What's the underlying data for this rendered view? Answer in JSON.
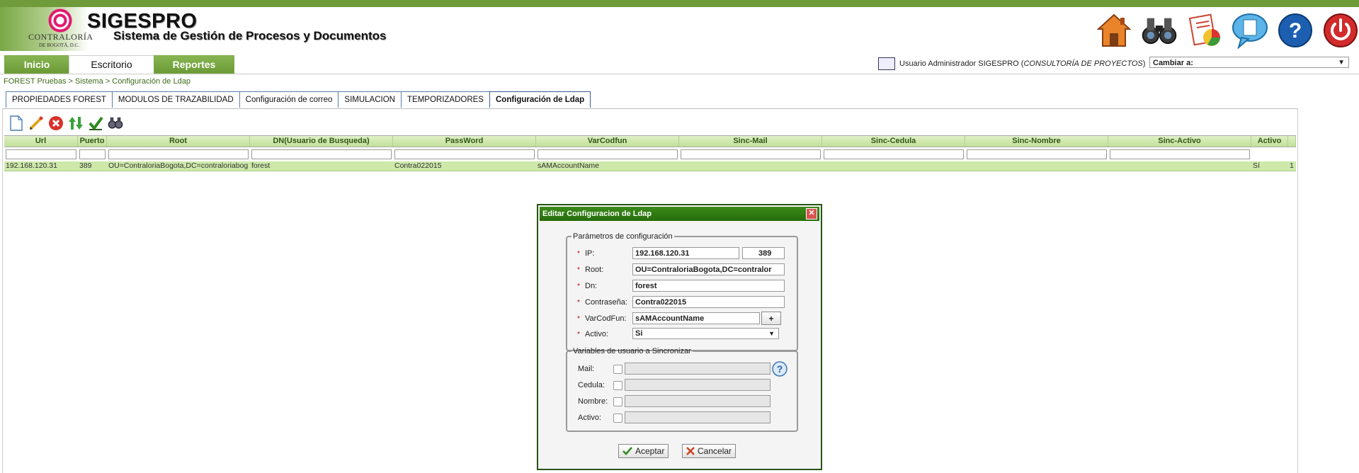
{
  "app": {
    "title": "SIGESPRO",
    "subtitle": "Sistema de Gestión de Procesos y Documentos",
    "logo_name": "CONTRALORÍA",
    "logo_sub": "DE BOGOTÁ, D.C."
  },
  "top_icons": [
    "home-icon",
    "binoculars-icon",
    "reports-icon",
    "chat-icon",
    "help-icon",
    "power-icon"
  ],
  "main_tabs": [
    {
      "label": "Inicio"
    },
    {
      "label": "Escritorio"
    },
    {
      "label": "Reportes"
    }
  ],
  "user": {
    "prefix": "Usuario Administrador SIGESPRO (",
    "role": "CONSULTORÍA DE PROYECTOS",
    "suffix": ")"
  },
  "switch": {
    "label": "Cambiar a:"
  },
  "breadcrumb": "FOREST Pruebas > Sistema > Configuración de Ldap",
  "sub_tabs": [
    {
      "label": "PROPIEDADES FOREST"
    },
    {
      "label": "MODULOS DE TRAZABILIDAD"
    },
    {
      "label": "Configuración de correo"
    },
    {
      "label": "SIMULACION"
    },
    {
      "label": "TEMPORIZADORES"
    },
    {
      "label": "Configuración de Ldap"
    }
  ],
  "toolbar_icons": [
    "new-icon",
    "edit-icon",
    "delete-icon",
    "sync-icon",
    "check-icon",
    "search-icon"
  ],
  "grid": {
    "columns": [
      "Url",
      "Puerto",
      "Root",
      "DN(Usuario de Busqueda)",
      "PassWord",
      "VarCodfun",
      "Sinc-Mail",
      "Sinc-Cedula",
      "Sinc-Nombre",
      "Sinc-Activo",
      "Activo"
    ],
    "rows": [
      [
        "192.168.120.31",
        "389",
        "OU=ContraloriaBogota,DC=contraloriabog",
        "forest",
        "Contra022015",
        "sAMAccountName",
        "",
        "",
        "",
        "",
        "Sí",
        "1"
      ]
    ]
  },
  "dialog": {
    "title": "Editar Configuracion de Ldap",
    "params_legend": "Parámetros de configuración",
    "fields": {
      "ip_label": "IP:",
      "ip_value": "192.168.120.31",
      "port_value": "389",
      "root_label": "Root:",
      "root_value": "OU=ContraloriaBogota,DC=contralor",
      "dn_label": "Dn:",
      "dn_value": "forest",
      "pass_label": "Contraseña:",
      "pass_value": "Contra022015",
      "varcod_label": "VarCodFun:",
      "varcod_value": "sAMAccountName",
      "plus": "+",
      "activo_label": "Activo:",
      "activo_value": "Si"
    },
    "sync_legend": "Variables de usuario a Sincronizar",
    "sync": {
      "mail_label": "Mail:",
      "cedula_label": "Cedula:",
      "nombre_label": "Nombre:",
      "activo_label": "Activo:"
    },
    "accept": "Aceptar",
    "cancel": "Cancelar"
  }
}
